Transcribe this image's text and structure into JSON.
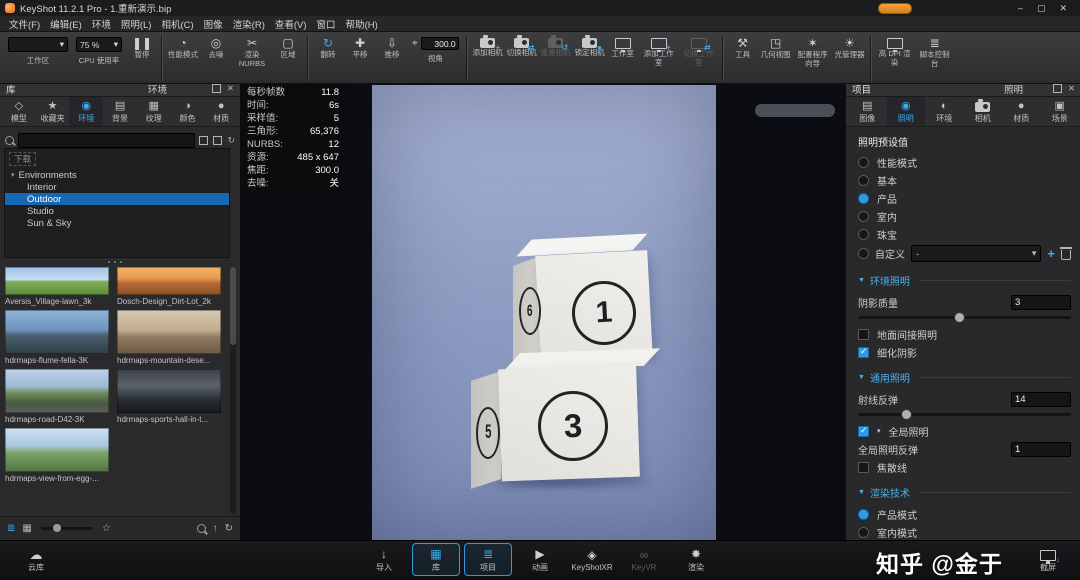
{
  "colors": {
    "accent": "#35aef0",
    "selection": "#1668b3",
    "watermark": "#ffffff",
    "render_background": "#8c9bc4"
  },
  "titlebar": {
    "title": "KeyShot 11.2.1 Pro - 1.重新演示.bip"
  },
  "menubar": {
    "items": [
      "文件(F)",
      "编辑(E)",
      "环境",
      "照明(L)",
      "相机(C)",
      "图像",
      "渲染(R)",
      "查看(V)",
      "窗口",
      "帮助(H)"
    ]
  },
  "toolbar": {
    "workspace": {
      "label": "工作区"
    },
    "cpu": {
      "value": "75 %",
      "label": "CPU 使用率"
    },
    "pause": [
      {
        "label": "暂停",
        "icon": "pause"
      }
    ],
    "perf": [
      {
        "label": "性能模式",
        "icon": "gauge"
      },
      {
        "label": "去噪",
        "icon": "denoise"
      },
      {
        "label": "渲染NURBS",
        "icon": "nurbs"
      },
      {
        "label": "区域",
        "icon": "region"
      }
    ],
    "view": [
      {
        "label": "翻转",
        "icon": "flip",
        "active": true
      },
      {
        "label": "平移",
        "icon": "pan"
      },
      {
        "label": "推移",
        "icon": "dolly"
      }
    ],
    "fov": {
      "value": "300.0",
      "label": "视角"
    },
    "camera": [
      {
        "label": "添加相机",
        "icon": "camera-add"
      },
      {
        "label": "切换相机",
        "icon": "camera-switch"
      },
      {
        "label": "重置相机",
        "icon": "camera-reset",
        "disabled": true
      },
      {
        "label": "锁定相机",
        "icon": "camera-lock"
      }
    ],
    "studio": [
      {
        "label": "工作室",
        "icon": "studio"
      },
      {
        "label": "添加工作室",
        "icon": "studio-add"
      },
      {
        "label": "切换工作室",
        "icon": "studio-switch",
        "disabled": true
      }
    ],
    "tools": [
      {
        "label": "工具",
        "icon": "tools"
      },
      {
        "label": "几何视图",
        "icon": "geometry"
      },
      {
        "label": "配置程序向导",
        "icon": "wizard"
      },
      {
        "label": "光管理器",
        "icon": "light-manager"
      }
    ],
    "misc": [
      {
        "label": "高 DPI 渲染",
        "icon": "hidpi"
      },
      {
        "label": "脚本控制台",
        "icon": "script"
      }
    ]
  },
  "library": {
    "panel_title": "库",
    "panel_subtitle": "环境",
    "tabs": [
      {
        "label": "模型",
        "icon": "model"
      },
      {
        "label": "收藏夹",
        "icon": "favorites"
      },
      {
        "label": "环境",
        "icon": "environment",
        "active": true
      },
      {
        "label": "背景",
        "icon": "backplate"
      },
      {
        "label": "纹理",
        "icon": "texture"
      },
      {
        "label": "颜色",
        "icon": "color"
      },
      {
        "label": "材质",
        "icon": "material"
      }
    ],
    "search_placeholder": "",
    "tree": {
      "hint": "下载",
      "root": "Environments",
      "children": [
        {
          "label": "Interior"
        },
        {
          "label": "Outdoor",
          "selected": true
        },
        {
          "label": "Studio"
        },
        {
          "label": "Sun & Sky"
        }
      ]
    },
    "thumbnails": [
      {
        "name": "Aversis_Village-lawn_3k",
        "style": "lawn"
      },
      {
        "name": "Dosch-Design_Dirt-Lot_2k",
        "style": "dirt"
      },
      {
        "name": "hdrmaps-flume-fella-3K",
        "style": "flume"
      },
      {
        "name": "hdrmaps-mountain-dese...",
        "style": "mountain"
      },
      {
        "name": "hdrmaps-road-D42-3K",
        "style": "road"
      },
      {
        "name": "hdrmaps-sports-hall-in-t...",
        "style": "hall"
      },
      {
        "name": "hdrmaps-view-from-egg-...",
        "style": "view"
      }
    ]
  },
  "stats": {
    "rows": [
      {
        "label": "每秒帧数",
        "value": "11.8"
      },
      {
        "label": "时间:",
        "value": "6s"
      },
      {
        "label": "采样值:",
        "value": "5"
      },
      {
        "label": "三角形:",
        "value": "65,376"
      },
      {
        "label": "NURBS:",
        "value": "12"
      },
      {
        "label": "资源:",
        "value": "485 x 647"
      },
      {
        "label": "焦距:",
        "value": "300.0"
      },
      {
        "label": "去噪:",
        "value": "关"
      }
    ]
  },
  "viewport": {
    "dice": [
      {
        "front": "1",
        "side": "6"
      },
      {
        "front": "3",
        "side": "5"
      }
    ]
  },
  "project": {
    "panel_title": "项目",
    "panel_subtitle": "照明",
    "tabs": [
      {
        "label": "图像",
        "icon": "image"
      },
      {
        "label": "照明",
        "icon": "lighting",
        "active": true
      },
      {
        "label": "环境",
        "icon": "environment2"
      },
      {
        "label": "相机",
        "icon": "camera-tab"
      },
      {
        "label": "材质",
        "icon": "material2"
      },
      {
        "label": "场景",
        "icon": "scene"
      }
    ],
    "presets": {
      "title": "照明预设值",
      "options": [
        {
          "label": "性能模式"
        },
        {
          "label": "基本"
        },
        {
          "label": "产品",
          "selected": true
        },
        {
          "label": "室内"
        },
        {
          "label": "珠宝"
        }
      ],
      "custom": {
        "label": "自定义",
        "value": "-"
      }
    },
    "env": {
      "title": "环境照明",
      "shadow_label": "阴影质量",
      "shadow_value": "3",
      "ground_label": "地面间接照明",
      "ground_checked": false,
      "refine_label": "细化阴影",
      "refine_checked": true
    },
    "general": {
      "title": "通用照明",
      "ray_label": "射线反弹",
      "ray_value": "14",
      "gi_label": "全局照明",
      "gi_checked": true,
      "gi_bounce_label": "全局照明反弹",
      "gi_bounce_value": "1",
      "caustics_label": "焦散线",
      "caustics_checked": false
    },
    "technique": {
      "title": "渲染技术",
      "options": [
        {
          "label": "产品模式",
          "selected": true
        },
        {
          "label": "室内模式"
        }
      ]
    }
  },
  "bottombar": {
    "cloud": {
      "label": "云库",
      "icon": "cloud"
    },
    "items": [
      {
        "label": "导入",
        "icon": "import"
      },
      {
        "label": "库",
        "icon": "library",
        "active": true
      },
      {
        "label": "项目",
        "icon": "project",
        "active": true
      },
      {
        "label": "动画",
        "icon": "animation"
      },
      {
        "label": "KeyShotXR",
        "icon": "xr"
      },
      {
        "label": "KeyVR",
        "icon": "vr",
        "disabled": true
      },
      {
        "label": "渲染",
        "icon": "render"
      }
    ],
    "screenshot": {
      "label": "截屏",
      "icon": "screenshot"
    },
    "watermark": "知乎 @金于"
  }
}
